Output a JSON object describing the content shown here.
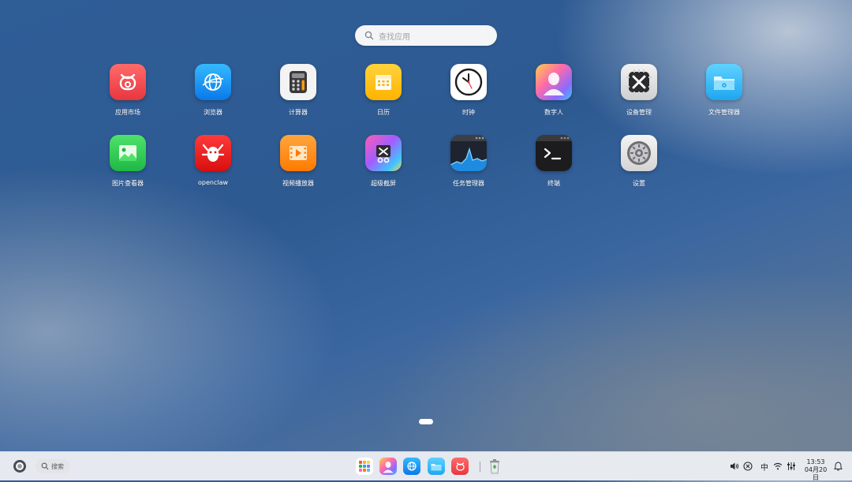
{
  "search": {
    "placeholder": "查找应用"
  },
  "apps": [
    {
      "label": "应用市场",
      "icon": "app-market-icon"
    },
    {
      "label": "浏览器",
      "icon": "browser-icon"
    },
    {
      "label": "计算器",
      "icon": "calculator-icon"
    },
    {
      "label": "日历",
      "icon": "calendar-icon"
    },
    {
      "label": "时钟",
      "icon": "clock-icon"
    },
    {
      "label": "数字人",
      "icon": "digital-human-icon"
    },
    {
      "label": "设备管理",
      "icon": "device-manager-icon"
    },
    {
      "label": "文件管理器",
      "icon": "file-manager-icon"
    },
    {
      "label": "图片查看器",
      "icon": "image-viewer-icon"
    },
    {
      "label": "openclaw",
      "icon": "openclaw-icon"
    },
    {
      "label": "视频播放器",
      "icon": "video-player-icon"
    },
    {
      "label": "超级截屏",
      "icon": "screenshot-icon"
    },
    {
      "label": "任务管理器",
      "icon": "task-manager-icon"
    },
    {
      "label": "终端",
      "icon": "terminal-icon"
    },
    {
      "label": "设置",
      "icon": "settings-icon"
    }
  ],
  "taskbar": {
    "search_label": "搜索",
    "dock": [
      "launcher-icon",
      "digital-human-icon",
      "browser-icon",
      "file-manager-icon",
      "app-market-icon",
      "trash-icon"
    ],
    "tray": {
      "input_method": "中"
    },
    "clock": {
      "time": "13:53",
      "date": "04月20日"
    }
  },
  "colors": {
    "accent": "#2f5d96",
    "taskbar": "#eceef2"
  }
}
